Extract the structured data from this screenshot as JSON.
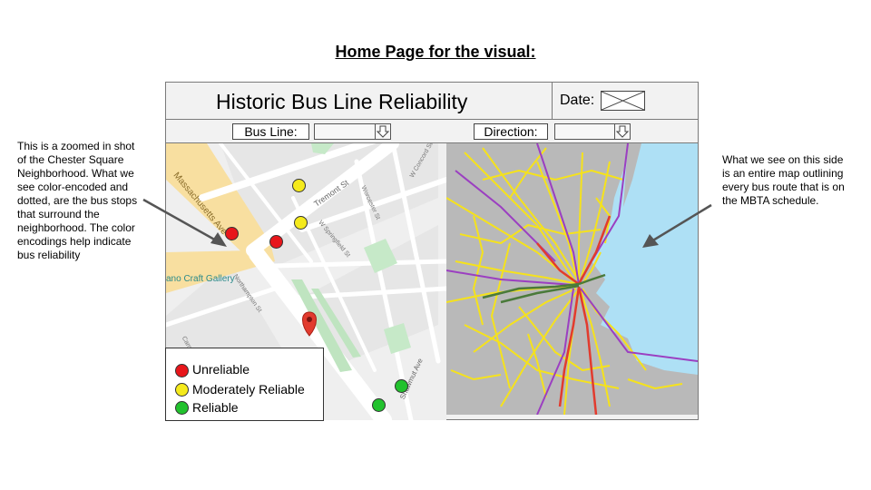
{
  "heading": "Home Page for the visual:",
  "app": {
    "title": "Historic Bus Line Reliability",
    "date_label": "Date:"
  },
  "filters": {
    "bus_line_label": "Bus Line:",
    "direction_label": "Direction:"
  },
  "left_note": "This is a zoomed in shot of the Chester Square Neighborhood. What we see color-encoded and dotted, are the bus stops that surround the neighborhood. The color encodings help indicate bus reliability",
  "right_note": "What we see on this side is an entire map outlining every bus route that is on the MBTA schedule.",
  "map_labels": {
    "massachusetts_ave": "Massachusetts Ave",
    "tremont_st": "Tremont St",
    "worcester_st": "Worcester St",
    "w_concord_st": "W Concord St",
    "w_springfield_st": "W Springfield St",
    "northampton_st": "Northampton St",
    "shawmut_ave": "Shawmut Ave",
    "camden_st": "Camden St",
    "craft_gallery": "ano Craft Gallery"
  },
  "legend": {
    "items": [
      {
        "label": "Unreliable",
        "color": "#e8161b"
      },
      {
        "label": "Moderately Reliable",
        "color": "#f5ea1c"
      },
      {
        "label": "Reliable",
        "color": "#22c22e"
      }
    ]
  },
  "colors": {
    "unreliable": "#e8161b",
    "moderate": "#f5ea1c",
    "reliable": "#22c22e",
    "water": "#aee0f5",
    "land": "#b9b9b9",
    "bus_route": "#f5e21c",
    "purple_route": "#9b3fc1",
    "red_line": "#e23b2e",
    "green_line": "#4a7a3a"
  }
}
